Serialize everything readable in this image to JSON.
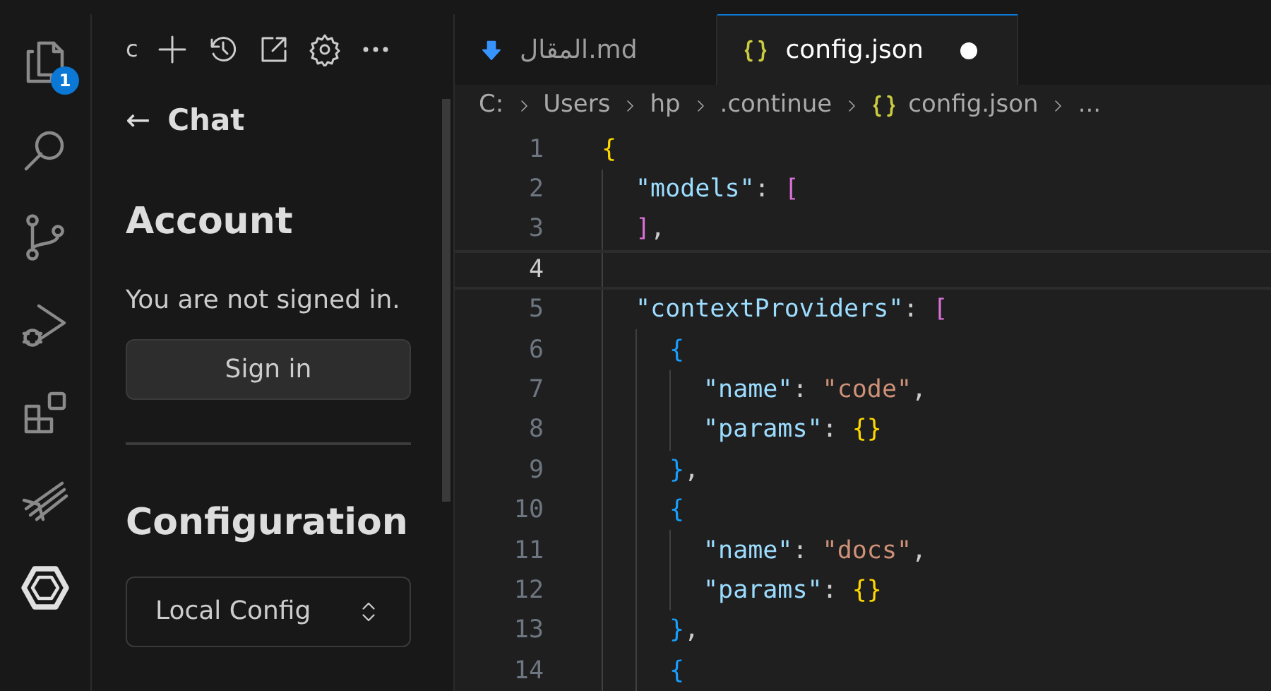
{
  "activity_bar": {
    "items": [
      {
        "kind": "files",
        "badge": "1",
        "selected": false
      },
      {
        "kind": "search",
        "selected": false
      },
      {
        "kind": "source-control",
        "selected": false
      },
      {
        "kind": "run-debug",
        "selected": false
      },
      {
        "kind": "extensions",
        "selected": false
      },
      {
        "kind": "lines",
        "selected": false
      },
      {
        "kind": "hexagon",
        "selected": true
      }
    ]
  },
  "sidebar": {
    "toolbar_label": "c",
    "back_label": "←",
    "back_title": "Chat",
    "account_heading": "Account",
    "account_text": "You are not signed in.",
    "sign_in_button": "Sign in",
    "config_heading": "Configuration",
    "config_select": "Local Config"
  },
  "tabs": [
    {
      "label": "المقال.md",
      "kind": "markdown",
      "selected": false,
      "modified": false
    },
    {
      "label": "config.json",
      "kind": "json",
      "selected": true,
      "modified": true
    }
  ],
  "breadcrumb": [
    {
      "text": "C:",
      "kind": "folder"
    },
    {
      "text": "Users",
      "kind": "folder"
    },
    {
      "text": "hp",
      "kind": "folder"
    },
    {
      "text": ".continue",
      "kind": "folder"
    },
    {
      "text": "config.json",
      "kind": "json"
    },
    {
      "text": "...",
      "kind": "folder"
    }
  ],
  "editor": {
    "lines": [
      {
        "number": "1",
        "current": false,
        "tokens": [
          {
            "text": "{",
            "kind": "brace1"
          }
        ]
      },
      {
        "number": "2",
        "current": false,
        "tokens": [
          {
            "text": "  \"models\"",
            "kind": "key"
          },
          {
            "text": ": ",
            "kind": "punct"
          },
          {
            "text": "[",
            "kind": "bracket2"
          }
        ]
      },
      {
        "number": "3",
        "current": false,
        "tokens": [
          {
            "text": "  ]",
            "kind": "bracket2"
          },
          {
            "text": ",",
            "kind": "punct"
          }
        ]
      },
      {
        "number": "4",
        "current": true
      },
      {
        "number": "5",
        "current": false,
        "tokens": [
          {
            "text": "  \"contextProviders\"",
            "kind": "key"
          },
          {
            "text": ": ",
            "kind": "punct"
          },
          {
            "text": "[",
            "kind": "bracket2"
          }
        ]
      },
      {
        "number": "6",
        "current": false,
        "tokens": [
          {
            "text": "    {",
            "kind": "brace3"
          }
        ]
      },
      {
        "number": "7",
        "current": false,
        "tokens": [
          {
            "text": "      \"name\"",
            "kind": "key"
          },
          {
            "text": ": ",
            "kind": "punct"
          },
          {
            "text": "\"code\"",
            "kind": "string"
          },
          {
            "text": ",",
            "kind": "punct"
          }
        ]
      },
      {
        "number": "8",
        "current": false,
        "tokens": [
          {
            "text": "      \"params\"",
            "kind": "key"
          },
          {
            "text": ": ",
            "kind": "punct"
          },
          {
            "text": "{}",
            "kind": "brace1"
          }
        ]
      },
      {
        "number": "9",
        "current": false,
        "tokens": [
          {
            "text": "    }",
            "kind": "brace3"
          },
          {
            "text": ",",
            "kind": "punct"
          }
        ]
      },
      {
        "number": "10",
        "current": false,
        "tokens": [
          {
            "text": "    {",
            "kind": "brace3"
          }
        ]
      },
      {
        "number": "11",
        "current": false,
        "tokens": [
          {
            "text": "      \"name\"",
            "kind": "key"
          },
          {
            "text": ": ",
            "kind": "punct"
          },
          {
            "text": "\"docs\"",
            "kind": "string"
          },
          {
            "text": ",",
            "kind": "punct"
          }
        ]
      },
      {
        "number": "12",
        "current": false,
        "tokens": [
          {
            "text": "      \"params\"",
            "kind": "key"
          },
          {
            "text": ": ",
            "kind": "punct"
          },
          {
            "text": "{}",
            "kind": "brace1"
          }
        ]
      },
      {
        "number": "13",
        "current": false,
        "tokens": [
          {
            "text": "    }",
            "kind": "brace3"
          },
          {
            "text": ",",
            "kind": "punct"
          }
        ]
      },
      {
        "number": "14",
        "current": false,
        "tokens": [
          {
            "text": "    {",
            "kind": "brace3"
          }
        ]
      }
    ]
  }
}
